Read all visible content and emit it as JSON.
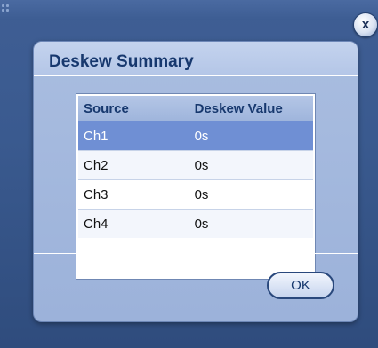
{
  "window": {
    "close_label": "x"
  },
  "dialog": {
    "title": "Deskew Summary",
    "table": {
      "headers": [
        "Source",
        "Deskew Value"
      ],
      "rows": [
        {
          "source": "Ch1",
          "value": "0s",
          "selected": true
        },
        {
          "source": "Ch2",
          "value": "0s",
          "selected": false
        },
        {
          "source": "Ch3",
          "value": "0s",
          "selected": false
        },
        {
          "source": "Ch4",
          "value": "0s",
          "selected": false
        }
      ]
    },
    "ok_label": "OK"
  },
  "colors": {
    "background": "#3a5a8f",
    "dialog": "#a9bde0",
    "title_text": "#17386e",
    "selected_row": "#6f8fd4"
  },
  "icons": {
    "grip": "grip-dots-icon",
    "close": "close-icon"
  }
}
